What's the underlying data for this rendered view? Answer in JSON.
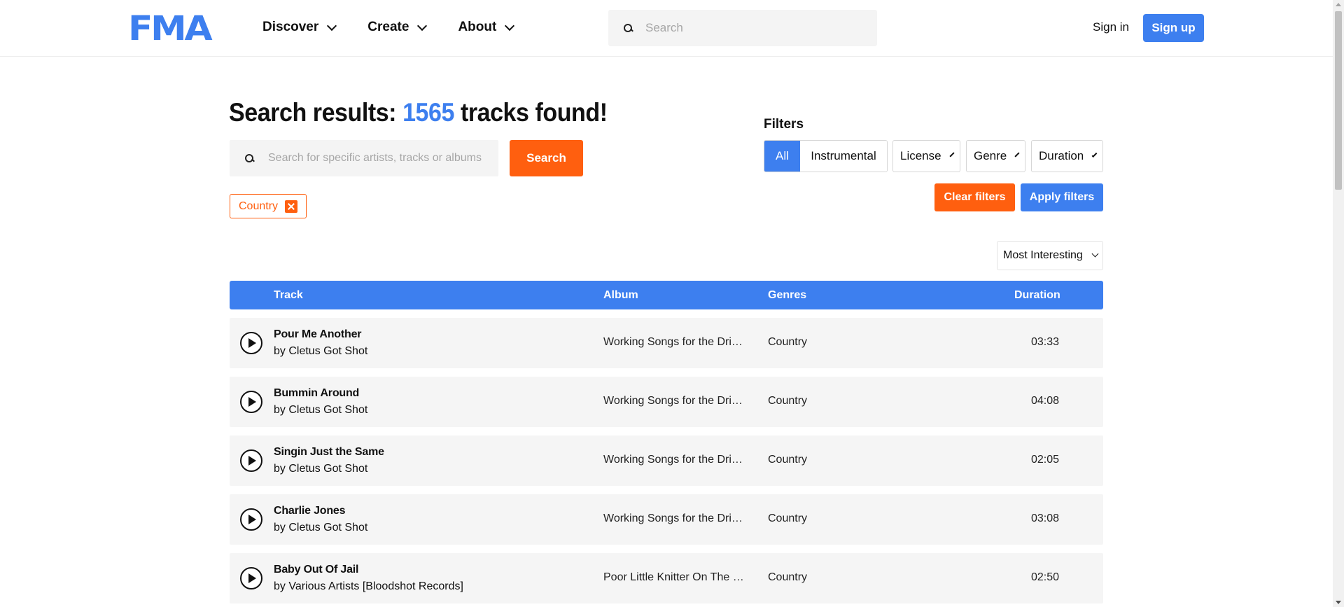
{
  "header": {
    "logo": "FMA",
    "nav": [
      {
        "label": "Discover"
      },
      {
        "label": "Create"
      },
      {
        "label": "About"
      }
    ],
    "search_placeholder": "Search",
    "sign_in": "Sign in",
    "sign_up": "Sign up"
  },
  "results": {
    "title_prefix": "Search results: ",
    "count": "1565",
    "title_suffix": " tracks found!",
    "search_placeholder": "Search for specific artists, tracks or albums",
    "search_button": "Search",
    "active_chip": "Country"
  },
  "filters": {
    "label": "Filters",
    "type_options": [
      "All",
      "Instrumental"
    ],
    "type_selected": "All",
    "license": "License",
    "genre": "Genre",
    "duration": "Duration",
    "clear": "Clear filters",
    "apply": "Apply filters",
    "sort": "Most Interesting"
  },
  "table": {
    "headers": {
      "track": "Track",
      "album": "Album",
      "genres": "Genres",
      "duration": "Duration"
    },
    "rows": [
      {
        "title": "Pour Me Another",
        "by": "by ",
        "artist": "Cletus Got Shot",
        "album": "Working Songs for the Drinking Class",
        "genre": "Country",
        "duration": "03:33"
      },
      {
        "title": "Bummin Around",
        "by": "by ",
        "artist": "Cletus Got Shot",
        "album": "Working Songs for the Drinking Class",
        "genre": "Country",
        "duration": "04:08"
      },
      {
        "title": "Singin Just the Same",
        "by": "by ",
        "artist": "Cletus Got Shot",
        "album": "Working Songs for the Drinking Class",
        "genre": "Country",
        "duration": "02:05"
      },
      {
        "title": "Charlie Jones",
        "by": "by ",
        "artist": "Cletus Got Shot",
        "album": "Working Songs for the Drinking Class",
        "genre": "Country",
        "duration": "03:08"
      },
      {
        "title": "Baby Out Of Jail",
        "by": "by ",
        "artist": "Various Artists [Bloodshot Records]",
        "album": "Poor Little Knitter On The Road",
        "genre": "Country",
        "duration": "02:50"
      }
    ]
  },
  "colors": {
    "brand_blue": "#3d7fef",
    "accent_orange": "#ff5f0f"
  }
}
